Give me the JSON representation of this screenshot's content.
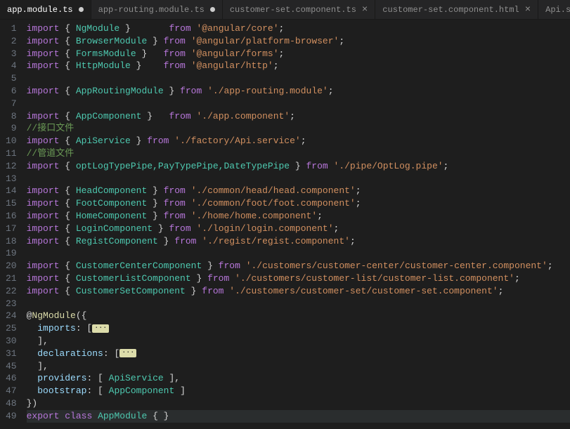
{
  "tabs": [
    {
      "label": "app.module.ts",
      "active": true,
      "dirty": true
    },
    {
      "label": "app-routing.module.ts",
      "active": false,
      "dirty": true
    },
    {
      "label": "customer-set.component.ts",
      "active": false,
      "close": "×"
    },
    {
      "label": "customer-set.component.html",
      "active": false,
      "close": "×"
    },
    {
      "label": "Api.servic",
      "active": false,
      "truncated": true
    }
  ],
  "kw_import": "import",
  "kw_from": "from",
  "kw_export": "export",
  "kw_class": "class",
  "lines": {
    "l1_sym": "NgModule",
    "l1_mod": "'@angular/core'",
    "l2_sym": "BrowserModule",
    "l2_mod": "'@angular/platform-browser'",
    "l3_sym": "FormsModule",
    "l3_mod": "'@angular/forms'",
    "l4_sym": "HttpModule",
    "l4_mod": "'@angular/http'",
    "l6_sym": "AppRoutingModule",
    "l6_mod": "'./app-routing.module'",
    "l8_sym": "AppComponent",
    "l8_mod": "'./app.component'",
    "l9_com": "//接口文件",
    "l10_sym": "ApiService",
    "l10_mod": "'./factory/Api.service'",
    "l11_com": "//管道文件",
    "l12_sym": "optLogTypePipe,PayTypePipe,DateTypePipe",
    "l12_mod": "'./pipe/OptLog.pipe'",
    "l14_sym": "HeadComponent",
    "l14_mod": "'./common/head/head.component'",
    "l15_sym": "FootComponent",
    "l15_mod": "'./common/foot/foot.component'",
    "l16_sym": "HomeComponent",
    "l16_mod": "'./home/home.component'",
    "l17_sym": "LoginComponent",
    "l17_mod": "'./login/login.component'",
    "l18_sym": "RegistComponent",
    "l18_mod": "'./regist/regist.component'",
    "l20_sym": "CustomerCenterComponent",
    "l20_mod": "'./customers/customer-center/customer-center.component'",
    "l21_sym": "CustomerListComponent",
    "l21_mod": "'./customers/customer-list/customer-list.component'",
    "l22_sym": "CustomerSetComponent",
    "l22_mod": "'./customers/customer-set/customer-set.component'",
    "l24_dec": "NgModule",
    "l25_prop": "imports",
    "l31_prop": "declarations",
    "l46_prop": "providers",
    "l46_val": "ApiService",
    "l47_prop": "bootstrap",
    "l47_val": "AppComponent",
    "l49_name": "AppModule"
  },
  "fold": "···",
  "gutter": [
    "1",
    "2",
    "3",
    "4",
    "5",
    "6",
    "7",
    "8",
    "9",
    "10",
    "11",
    "12",
    "13",
    "14",
    "15",
    "16",
    "17",
    "18",
    "19",
    "20",
    "21",
    "22",
    "23",
    "24",
    "25",
    "30",
    "31",
    "45",
    "46",
    "47",
    "48",
    "49"
  ]
}
